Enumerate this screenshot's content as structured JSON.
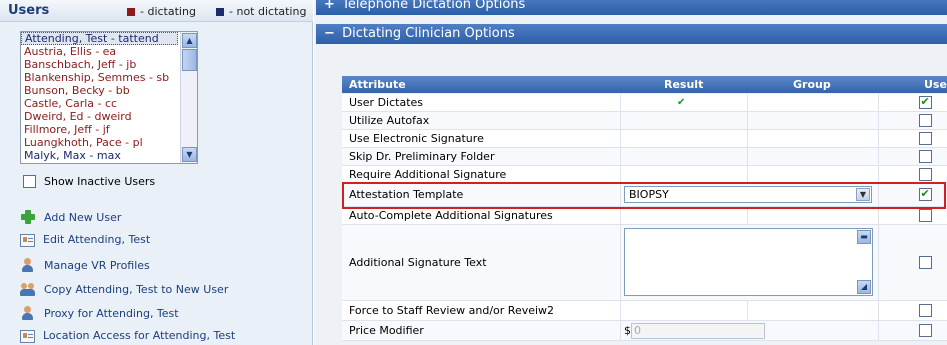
{
  "users_panel": {
    "title": "Users",
    "legend_dictating": "- dictating",
    "legend_not_dictating": "- not dictating",
    "legend_dictating_color": "#8b1a1a",
    "legend_not_dictating_color": "#1a2a6b",
    "users": [
      "Attending, Test - tattend",
      "Austria, Ellis - ea",
      "Banschbach, Jeff - jb",
      "Blankenship, Semmes - sb",
      "Bunson, Becky - bb",
      "Castle, Carla - cc",
      "Dweird, Ed - dweird",
      "Fillmore, Jeff - jf",
      "Luangkhoth, Pace - pl",
      "Malyk, Max - max"
    ],
    "show_inactive_label": "Show Inactive Users",
    "actions": [
      {
        "label": "Add New User",
        "icon": "plus-icon"
      },
      {
        "label": "Edit Attending, Test",
        "icon": "card-icon"
      },
      {
        "label": "Manage VR Profiles",
        "icon": "person-icon"
      },
      {
        "label": "Copy Attending, Test to New User",
        "icon": "people-icon"
      },
      {
        "label": "Proxy for Attending, Test",
        "icon": "person-icon"
      },
      {
        "label": "Location Access for Attending, Test",
        "icon": "card-icon"
      }
    ]
  },
  "sections": {
    "telephone": {
      "toggle": "+",
      "title": "Telephone Dictation Options"
    },
    "dictating": {
      "toggle": "−",
      "title": "Dictating Clinician Options"
    }
  },
  "grid": {
    "headers": {
      "attribute": "Attribute",
      "result": "Result",
      "group": "Group",
      "user": "User"
    },
    "rows": {
      "user_dictates": {
        "label": "User Dictates",
        "result_check": "✔",
        "user_checked": true
      },
      "utilize_autofax": {
        "label": "Utilize Autofax",
        "user_checked": false
      },
      "use_esig": {
        "label": "Use Electronic Signature",
        "user_checked": false
      },
      "skip_prelim": {
        "label": "Skip Dr. Preliminary Folder",
        "user_checked": false
      },
      "require_addl_sig": {
        "label": "Require Additional Signature",
        "user_checked": false
      },
      "attestation": {
        "label": "Attestation Template",
        "selected": "BIOPSY",
        "user_checked": true
      },
      "auto_complete": {
        "label": "Auto-Complete Additional Signatures",
        "user_checked": false
      },
      "addl_sig_text": {
        "label": "Additional Signature Text",
        "text": "",
        "user_checked": false
      },
      "force_staff": {
        "label": "Force to Staff Review and/or Reveiw2",
        "user_checked": false
      },
      "price_modifier": {
        "label": "Price Modifier",
        "currency": "$",
        "value": "0",
        "user_checked": false
      }
    }
  }
}
